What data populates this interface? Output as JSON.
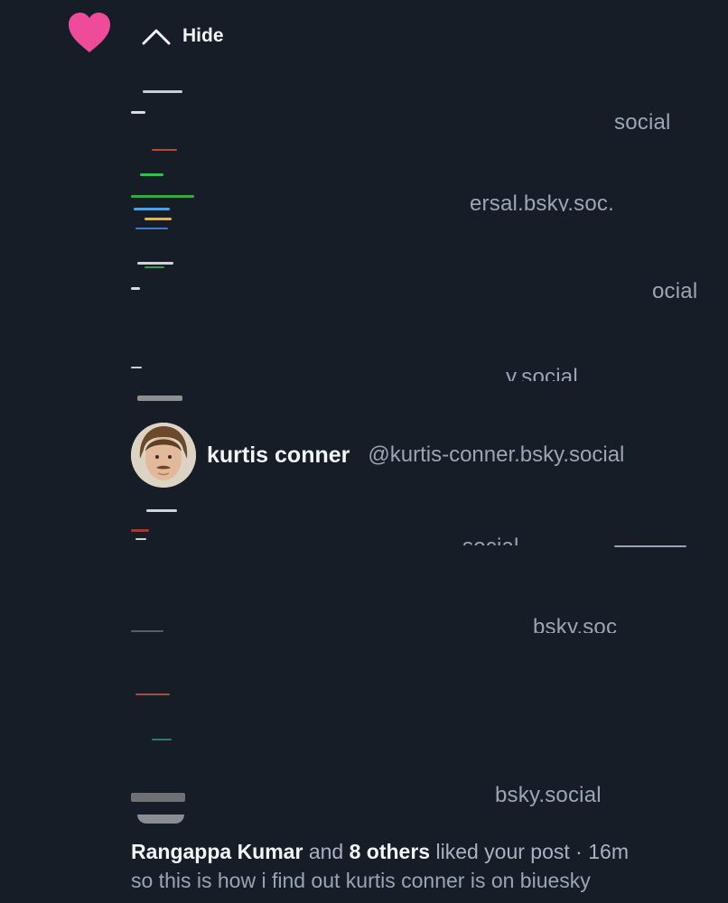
{
  "header": {
    "icon": "heart-icon",
    "icon_color": "#ee4b9b",
    "toggle_icon": "chevron-up-icon",
    "toggle_label": "Hide"
  },
  "obscured_rows": [
    {
      "handle_fragment": "social"
    },
    {
      "handle_fragment": "ersal.bsky.soc."
    },
    {
      "handle_fragment": "ocial"
    },
    {
      "handle_fragment": "y.social"
    },
    {
      "handle_fragment": "social"
    },
    {
      "handle_fragment": "bsky.soc"
    },
    {
      "handle_fragment": "bsky.social"
    }
  ],
  "visible_user": {
    "name": "kurtis conner",
    "handle": "@kurtis-conner.bsky.social"
  },
  "notification": {
    "actor": "Rangappa Kumar",
    "conjunction": "and",
    "others": "8 others",
    "action": "liked your post",
    "separator": "·",
    "time": "16m",
    "post_text": "so this is how i find out kurtis conner is on biuesky"
  },
  "colors": {
    "background": "#171d27",
    "heart": "#ee4b9b",
    "muted_text": "#9aa5b3"
  }
}
